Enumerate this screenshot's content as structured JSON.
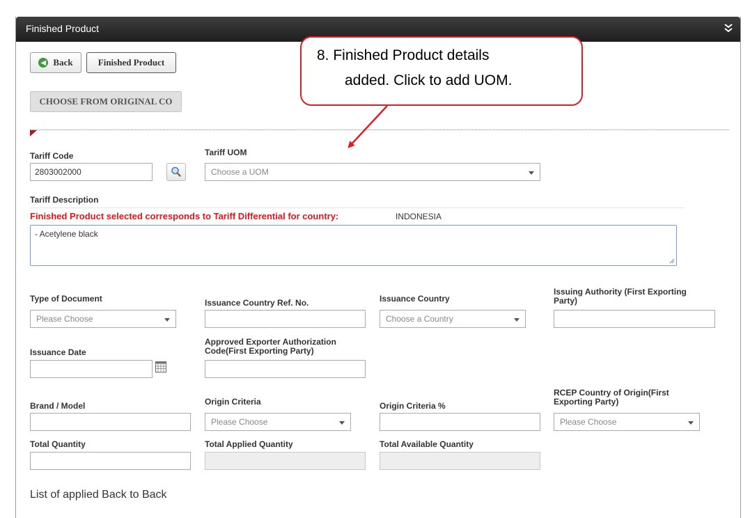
{
  "panel": {
    "title": "Finished Product"
  },
  "buttons": {
    "back": "Back",
    "finished_product": "Finished Product",
    "choose_original": "CHOOSE FROM ORIGINAL CO"
  },
  "callout": {
    "line1": "8. Finished Product details",
    "line2": "added. Click to add UOM."
  },
  "fields": {
    "tariff_code": {
      "label": "Tariff Code",
      "value": "2803002000"
    },
    "tariff_uom": {
      "label": "Tariff UOM",
      "placeholder": "Choose a UOM"
    },
    "tariff_description": {
      "label": "Tariff Description",
      "value": "- Acetylene black"
    },
    "tariff_warning": {
      "text": "Finished Product selected corresponds to Tariff Differential for country:",
      "country": "INDONESIA"
    },
    "type_of_document": {
      "label": "Type of Document",
      "placeholder": "Please Choose"
    },
    "issuance_country_ref": {
      "label": "Issuance Country Ref. No.",
      "value": ""
    },
    "issuance_country": {
      "label": "Issuance Country",
      "placeholder": "Choose a Country"
    },
    "issuing_authority": {
      "label_line1": "Issuing Authority (First Exporting",
      "label_line2": "Party)",
      "value": ""
    },
    "issuance_date": {
      "label": "Issuance Date",
      "value": ""
    },
    "approved_exporter": {
      "label_line1": "Approved Exporter Authorization",
      "label_line2": "Code(First Exporting Party)",
      "value": ""
    },
    "brand_model": {
      "label": "Brand / Model",
      "value": ""
    },
    "origin_criteria": {
      "label": "Origin Criteria",
      "placeholder": "Please Choose"
    },
    "origin_criteria_pct": {
      "label": "Origin Criteria %",
      "value": ""
    },
    "rcep_country": {
      "label_line1": "RCEP Country of Origin(First",
      "label_line2": "Exporting Party)",
      "placeholder": "Please Choose"
    },
    "total_quantity": {
      "label": "Total Quantity",
      "value": ""
    },
    "total_applied": {
      "label": "Total Applied Quantity",
      "value": ""
    },
    "total_available": {
      "label": "Total Available Quantity",
      "value": ""
    }
  },
  "list_heading": "List of applied Back to Back",
  "icons": [
    "arrow-circle-left-icon",
    "double-chevron-down-icon",
    "magnifier-icon",
    "calendar-icon",
    "chevron-down-icon"
  ],
  "colors": {
    "header_bg": "#2b2b2b",
    "warning_text": "#e0141a",
    "callout_border": "#e21b23",
    "back_icon": "#3b9a3b"
  }
}
